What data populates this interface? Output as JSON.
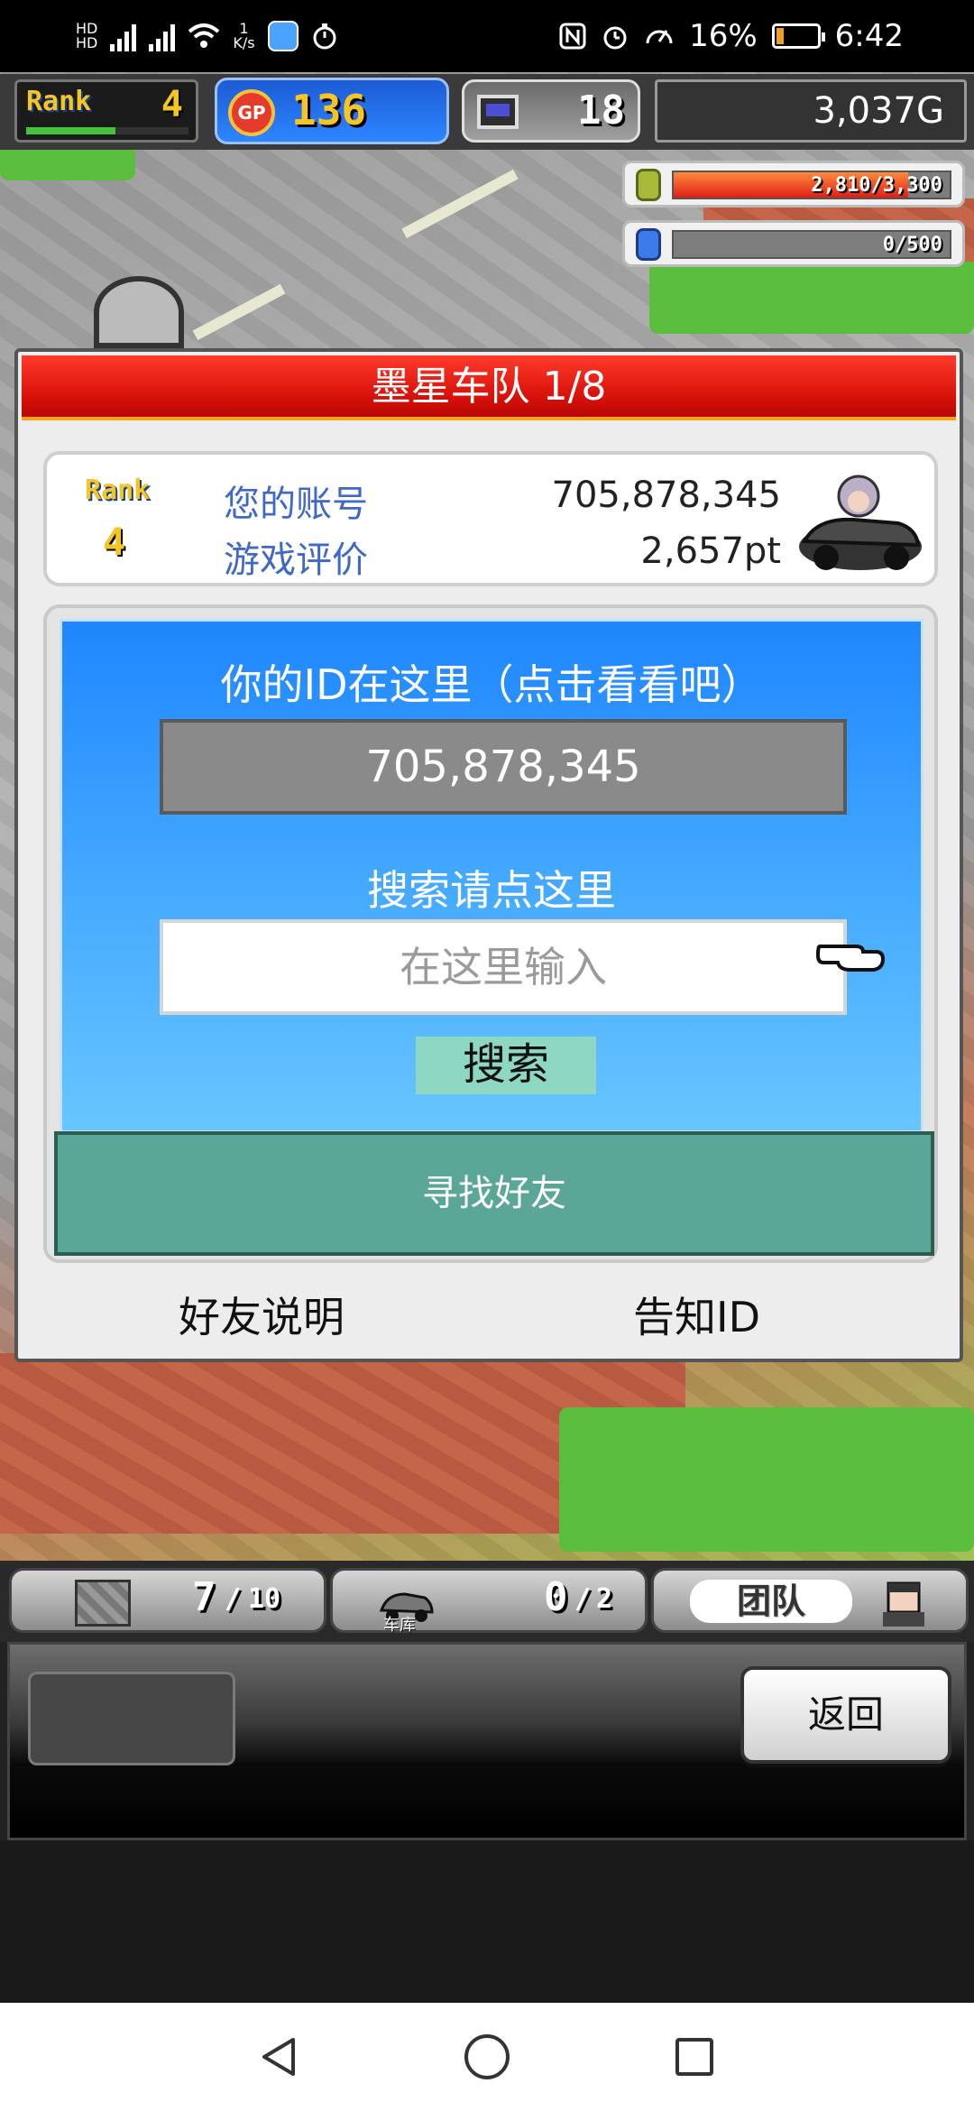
{
  "status_bar": {
    "network_speed_top": "1",
    "network_speed_unit": "K/s",
    "battery_percent": "16%",
    "time": "6:42"
  },
  "hud": {
    "rank_logo": "Rank",
    "rank_value": "4",
    "rank_progress": 0.55,
    "gp_icon_text": "GP",
    "gp_value": "136",
    "pc_value": "18",
    "money": "3,037G"
  },
  "resources": {
    "fuel": {
      "text": "2,810/3,300",
      "level": 0.85
    },
    "tank": {
      "text": "0/500",
      "level": 0
    }
  },
  "dialog": {
    "title": "墨星车队 1/8",
    "rank_logo": "Rank",
    "rank_value": "4",
    "account_label": "您的账号",
    "account_value": "705,878,345",
    "rating_label": "游戏评价",
    "rating_value": "2,657pt",
    "id_prompt": "你的ID在这里（点击看看吧）",
    "id_value": "705,878,345",
    "search_prompt": "搜索请点这里",
    "search_placeholder": "在这里输入",
    "search_button": "搜索",
    "find_friend_button": "寻找好友",
    "friend_help_link": "好友说明",
    "share_id_link": "告知ID"
  },
  "bottom_tabs": {
    "parts_count": "7",
    "parts_max": "10",
    "garage_label": "车库",
    "garage_count": "0",
    "garage_max": "2",
    "team_label": "团队"
  },
  "bottom_panel": {
    "back_button": "返回"
  },
  "icons": [
    "wifi-icon",
    "nfc-icon",
    "alarm-icon",
    "speed-icon",
    "battery-icon",
    "gp-coin-icon",
    "computer-icon",
    "fuel-can-icon",
    "tank-icon",
    "car-avatar-icon",
    "pointing-hand-icon",
    "parts-crate-icon",
    "garage-car-icon",
    "mechanic-icon",
    "nav-back-icon",
    "nav-home-icon",
    "nav-recents-icon"
  ]
}
